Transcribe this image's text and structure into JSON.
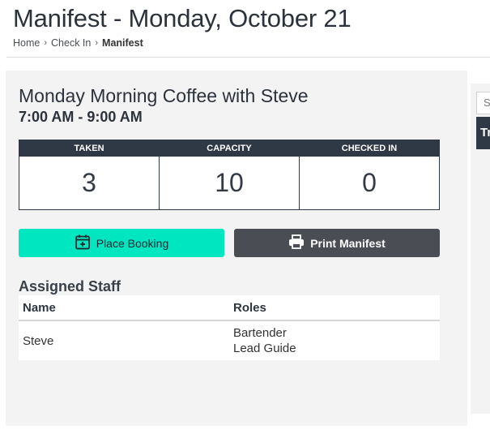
{
  "header": {
    "title": "Manifest - Monday, October 21",
    "breadcrumb": [
      {
        "label": "Home"
      },
      {
        "label": "Check In"
      },
      {
        "label": "Manifest"
      }
    ]
  },
  "event": {
    "name": "Monday Morning Coffee with Steve",
    "time": "7:00 AM - 9:00 AM"
  },
  "stats": [
    {
      "label": "TAKEN",
      "value": "3"
    },
    {
      "label": "CAPACITY",
      "value": "10"
    },
    {
      "label": "CHECKED IN",
      "value": "0"
    }
  ],
  "actions": {
    "place_booking": "Place Booking",
    "print_manifest": "Print Manifest"
  },
  "staff": {
    "title": "Assigned Staff",
    "columns": [
      "Name",
      "Roles"
    ],
    "rows": [
      {
        "name": "Steve",
        "roles": [
          "Bartender",
          "Lead Guide"
        ]
      }
    ]
  },
  "side": {
    "search_placeholder": "S",
    "header": "Tr"
  },
  "colors": {
    "accent": "#00e6c0",
    "dark": "#2f3845",
    "button_dark": "#4a4d53"
  }
}
